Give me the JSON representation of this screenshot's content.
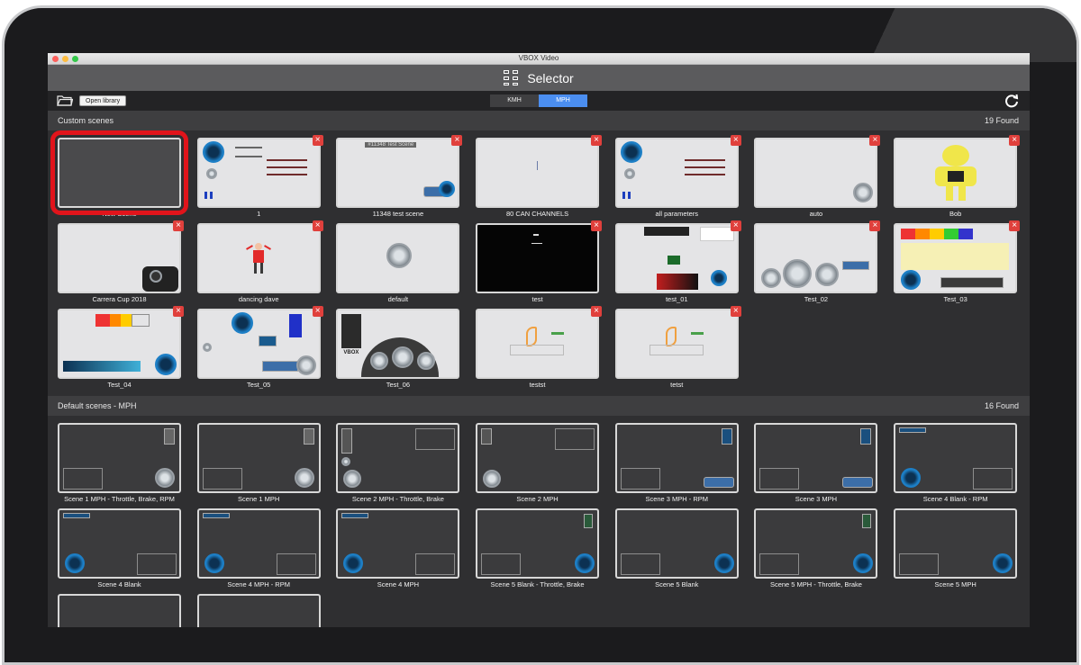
{
  "window": {
    "title": "VBOX Video"
  },
  "header": {
    "title": "Selector"
  },
  "toolbar": {
    "open_library": "Open library",
    "units": [
      "KMH",
      "MPH"
    ],
    "active_unit": "MPH"
  },
  "custom": {
    "title": "Custom scenes",
    "count": "19 Found",
    "tiles": [
      {
        "label": "New Scene"
      },
      {
        "label": "1"
      },
      {
        "label": "11348 test scene"
      },
      {
        "label": "80 CAN CHANNELS"
      },
      {
        "label": "all parameters"
      },
      {
        "label": "auto"
      },
      {
        "label": "Bob"
      },
      {
        "label": "Carrera Cup 2018"
      },
      {
        "label": "dancing dave"
      },
      {
        "label": "default"
      },
      {
        "label": "test"
      },
      {
        "label": "test_01"
      },
      {
        "label": "Test_02"
      },
      {
        "label": "Test_03"
      },
      {
        "label": "Test_04"
      },
      {
        "label": "Test_05"
      },
      {
        "label": "Test_06"
      },
      {
        "label": "testst"
      },
      {
        "label": "tetst"
      }
    ],
    "thumb_text": {
      "test_scene": "#11348 Test Scene",
      "vbox": "VBOX",
      "speed_000": "000"
    }
  },
  "defaults": {
    "title": "Default scenes - MPH",
    "count": "16 Found",
    "tiles": [
      {
        "label": "Scene 1 MPH - Throttle, Brake, RPM"
      },
      {
        "label": "Scene 1 MPH"
      },
      {
        "label": "Scene 2 MPH - Throttle, Brake"
      },
      {
        "label": "Scene 2 MPH"
      },
      {
        "label": "Scene 3 MPH - RPM"
      },
      {
        "label": "Scene 3 MPH"
      },
      {
        "label": "Scene 4 Blank - RPM"
      },
      {
        "label": "Scene 4 Blank"
      },
      {
        "label": "Scene 4 MPH - RPM"
      },
      {
        "label": "Scene 4 MPH"
      },
      {
        "label": "Scene 5 Blank - Throttle, Brake"
      },
      {
        "label": "Scene 5 Blank"
      },
      {
        "label": "Scene 5 MPH - Throttle, Brake"
      },
      {
        "label": "Scene 5 MPH"
      },
      {
        "label": ""
      },
      {
        "label": ""
      }
    ]
  },
  "icons": {
    "delete": "close-icon",
    "folder": "folder-icon",
    "refresh": "refresh-icon",
    "selector": "selector-icon"
  },
  "colors": {
    "accent": "#4b8ef0",
    "selection": "#e1141b",
    "delete": "#e0403c"
  }
}
